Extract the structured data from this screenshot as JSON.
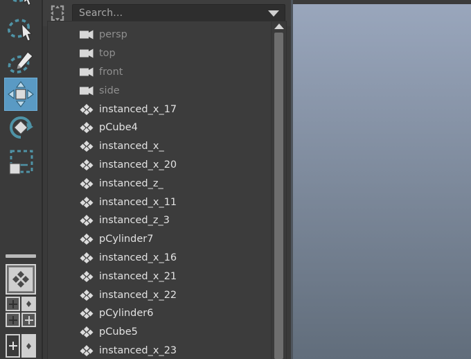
{
  "toolbar": {
    "name": "tool-shelf",
    "tools": [
      {
        "id": "lasso-select-partial",
        "label": "Lasso Select",
        "icon": "lasso-icon",
        "selected": false
      },
      {
        "id": "lasso-select",
        "label": "Lasso Select",
        "icon": "lasso-cursor-icon",
        "selected": false
      },
      {
        "id": "paint-select",
        "label": "Paint Select",
        "icon": "paint-brush-icon",
        "selected": false
      },
      {
        "id": "move-tool",
        "label": "Move Tool",
        "icon": "move-arrows-icon",
        "selected": true
      },
      {
        "id": "rotate-tool",
        "label": "Rotate Tool",
        "icon": "rotate-icon",
        "selected": false
      },
      {
        "id": "scale-tool",
        "label": "Scale Tool",
        "icon": "scale-icon",
        "selected": false
      }
    ],
    "snap_buttons": [
      {
        "id": "snap-to-grid",
        "icon": "snap-grid-icon"
      },
      {
        "id": "snap-to-curve",
        "icon": "snap-curve-icon"
      },
      {
        "id": "snap-to-point",
        "icon": "snap-point-icon"
      },
      {
        "id": "snap-to-projected",
        "icon": "snap-projected-icon"
      },
      {
        "id": "snap-to-view-plane",
        "icon": "snap-viewplane-icon"
      },
      {
        "id": "make-live",
        "icon": "make-live-icon"
      }
    ],
    "manip_button": {
      "id": "manipulator-toggle",
      "icon": "manipulator-icon"
    }
  },
  "outliner": {
    "frame_icon": "selection-frame-icon",
    "search": {
      "placeholder": "Search...",
      "value": "",
      "dropdown_icon": "chevron-down-icon"
    },
    "scrollbar": {
      "up_arrow_icon": "scroll-up-arrow-icon",
      "position": "top"
    },
    "items": [
      {
        "label": "persp",
        "icon": "camera-icon",
        "dim": true
      },
      {
        "label": "top",
        "icon": "camera-icon",
        "dim": true
      },
      {
        "label": "front",
        "icon": "camera-icon",
        "dim": true
      },
      {
        "label": "side",
        "icon": "camera-icon",
        "dim": true
      },
      {
        "label": "instanced_x_17",
        "icon": "mesh-icon",
        "dim": false
      },
      {
        "label": "pCube4",
        "icon": "mesh-icon",
        "dim": false
      },
      {
        "label": "instanced_x_",
        "icon": "mesh-icon",
        "dim": false
      },
      {
        "label": "instanced_x_20",
        "icon": "mesh-icon",
        "dim": false
      },
      {
        "label": "instanced_z_",
        "icon": "mesh-icon",
        "dim": false
      },
      {
        "label": "instanced_x_11",
        "icon": "mesh-icon",
        "dim": false
      },
      {
        "label": "instanced_z_3",
        "icon": "mesh-icon",
        "dim": false
      },
      {
        "label": "pCylinder7",
        "icon": "mesh-icon",
        "dim": false
      },
      {
        "label": "instanced_x_16",
        "icon": "mesh-icon",
        "dim": false
      },
      {
        "label": "instanced_x_21",
        "icon": "mesh-icon",
        "dim": false
      },
      {
        "label": "instanced_x_22",
        "icon": "mesh-icon",
        "dim": false
      },
      {
        "label": "pCylinder6",
        "icon": "mesh-icon",
        "dim": false
      },
      {
        "label": "pCube5",
        "icon": "mesh-icon",
        "dim": false
      },
      {
        "label": "instanced_x_23",
        "icon": "mesh-icon",
        "dim": false
      }
    ]
  },
  "viewport": {
    "name": "3d-viewport",
    "gradient_top": "#9aa7bd",
    "gradient_bottom": "#616d7b"
  },
  "colors": {
    "panel_bg": "#3a3a3a",
    "list_bg": "#3c3c3c",
    "accent_selected": "#5a9ac4",
    "icon_teal": "#4f93a6",
    "text": "#e2e2e2",
    "text_dim": "#8f8f8f"
  }
}
